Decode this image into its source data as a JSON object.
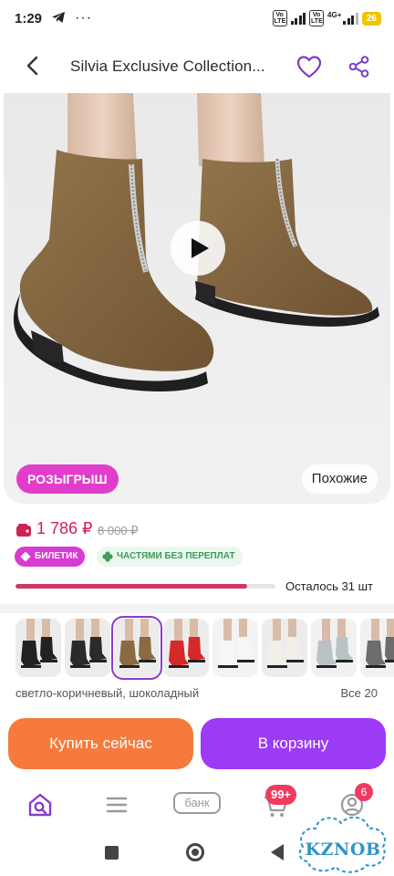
{
  "status_bar": {
    "time": "1:29",
    "dots": "···",
    "volte": "Vo LTE",
    "network": "4G+",
    "battery": "26"
  },
  "header": {
    "title": "Silvia Exclusive Collection..."
  },
  "gallery": {
    "raffle_label": "РОЗЫГРЫШ",
    "similar_label": "Похожие"
  },
  "price": {
    "current": "1 786 ₽",
    "old": "8 000 ₽",
    "ticket_badge": "БИЛЕТИК",
    "installments_badge": "ЧАСТЯМИ БЕЗ ПЕРЕПЛАТ",
    "stock_text": "Осталось 31 шт",
    "stock_fraction": 0.89
  },
  "colors": {
    "selected_name": "светло-коричневый, шоколадный",
    "all_label": "Все 20",
    "swatches": [
      {
        "name": "black-boots-1",
        "color": "#222222",
        "bg": "#ececec",
        "selected": false
      },
      {
        "name": "black-boots-2",
        "color": "#2a2a2a",
        "bg": "#ececec",
        "selected": false
      },
      {
        "name": "light-brown-boots",
        "color": "#8a6a40",
        "bg": "#ececec",
        "selected": true
      },
      {
        "name": "red-boots",
        "color": "#d42a2a",
        "bg": "#ececec",
        "selected": false
      },
      {
        "name": "white-boots-1",
        "color": "#f6f6f6",
        "bg": "#f3f3f3",
        "selected": false
      },
      {
        "name": "white-boots-2",
        "color": "#f2efe9",
        "bg": "#ececec",
        "selected": false
      },
      {
        "name": "grey-boots",
        "color": "#b9c2c4",
        "bg": "#f1f1f1",
        "selected": false
      },
      {
        "name": "dark-grey-boots",
        "color": "#6c6c6c",
        "bg": "#f1f1f1",
        "selected": false
      }
    ]
  },
  "actions": {
    "buy_now": "Купить сейчас",
    "add_to_cart": "В корзину"
  },
  "bottom_nav": {
    "bank_label": "банк",
    "cart_badge": "99+",
    "profile_badge": "6"
  },
  "watermark": "KZNOB",
  "theme": {
    "accent_purple": "#9b3bf5",
    "buy_orange": "#f57a3c",
    "price_red": "#cc2255",
    "raffle_pink": "#e23dca"
  }
}
